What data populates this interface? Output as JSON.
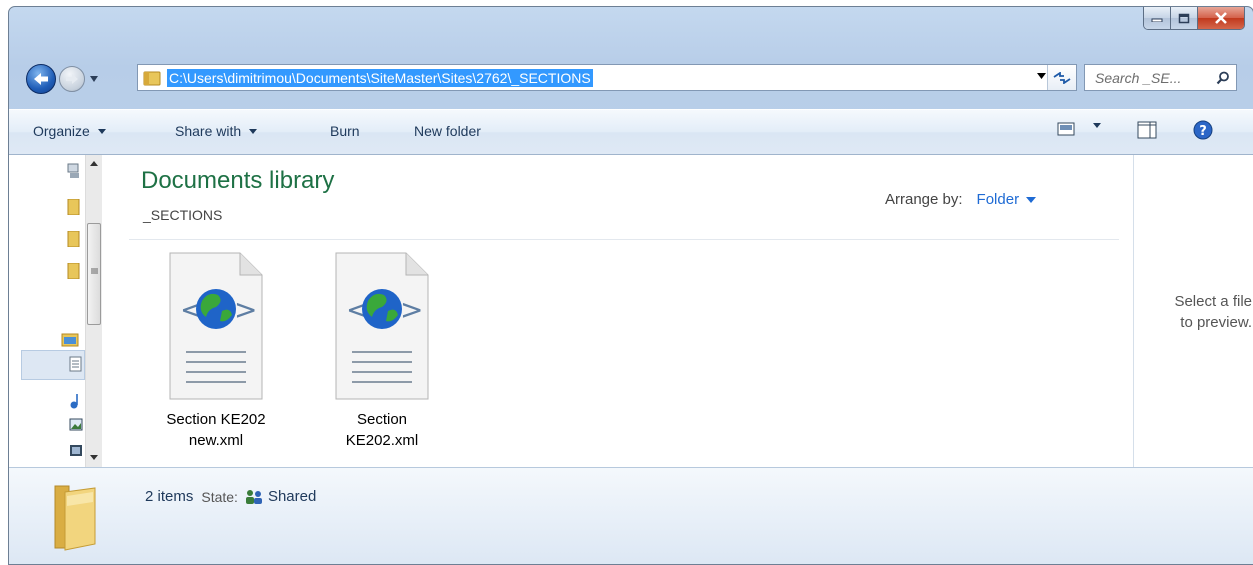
{
  "address": {
    "path": "C:\\Users\\dimitrimou\\Documents\\SiteMaster\\Sites\\2762\\_SECTIONS"
  },
  "search": {
    "placeholder": "Search _SE..."
  },
  "toolbar": {
    "organize": "Organize",
    "share_with": "Share with",
    "burn": "Burn",
    "new_folder": "New folder"
  },
  "library": {
    "title": "Documents library",
    "subtitle": "_SECTIONS",
    "arrange_label": "Arrange by:",
    "arrange_value": "Folder"
  },
  "files": [
    {
      "line1": "Section KE202",
      "line2": "new.xml",
      "icon": "xml-globe-document-icon"
    },
    {
      "line1": "Section",
      "line2": "KE202.xml",
      "icon": "xml-globe-document-icon"
    }
  ],
  "preview": {
    "line1": "Select a file",
    "line2": "to preview."
  },
  "details": {
    "count": "2 items",
    "state_label": "State:",
    "state_value": "Shared"
  },
  "colors": {
    "selection": "#3399ff",
    "library_title": "#1e7145",
    "link": "#1f6bd4",
    "close": "#c1391d"
  }
}
